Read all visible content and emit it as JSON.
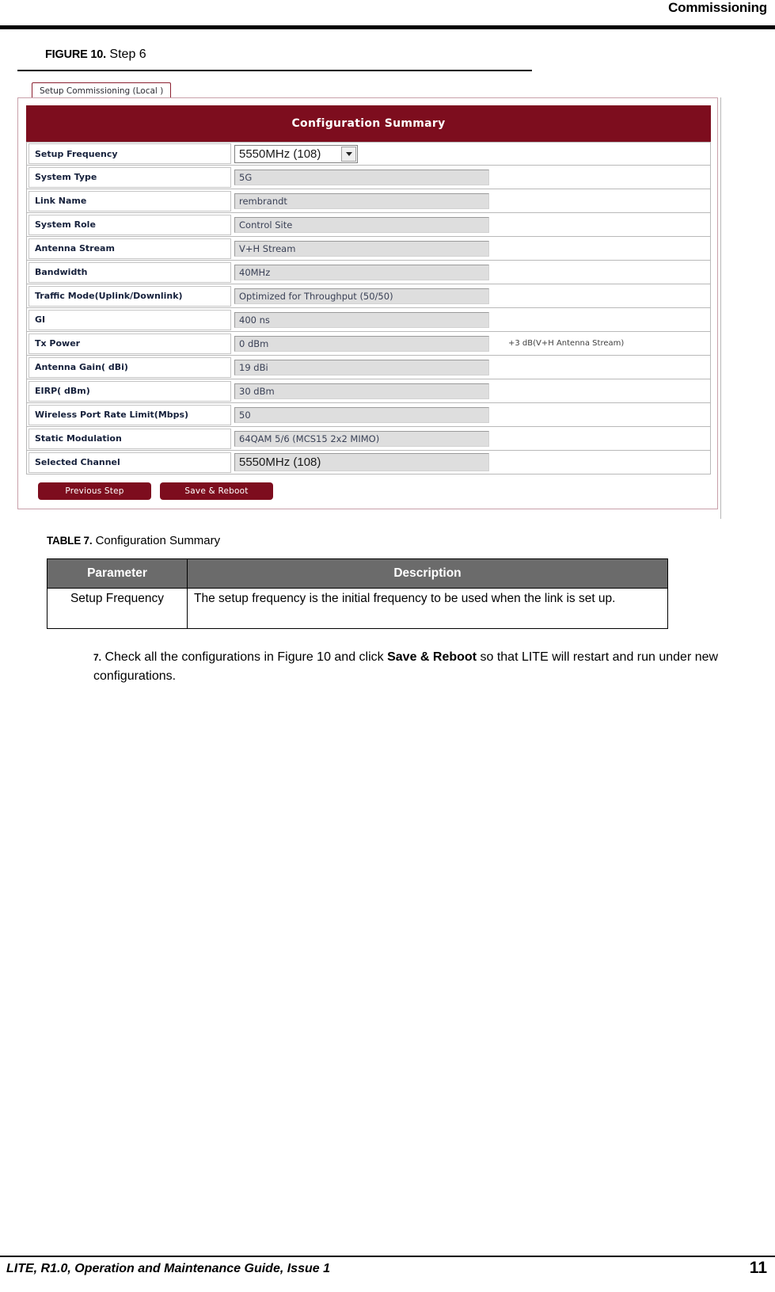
{
  "header": {
    "running_head": "Commissioning"
  },
  "figure": {
    "label": "FIGURE 10.",
    "title": "Step 6"
  },
  "screenshot": {
    "tab_label": "Setup Commissioning (Local )",
    "panel_title": "Configuration Summary",
    "rows": [
      {
        "label": "Setup Frequency",
        "value": "5550MHz (108)",
        "control": "select",
        "note": ""
      },
      {
        "label": "System Type",
        "value": "5G",
        "control": "text",
        "note": ""
      },
      {
        "label": "Link Name",
        "value": "rembrandt",
        "control": "text",
        "note": ""
      },
      {
        "label": "System Role",
        "value": "Control Site",
        "control": "text",
        "note": ""
      },
      {
        "label": "Antenna Stream",
        "value": "V+H Stream",
        "control": "text",
        "note": ""
      },
      {
        "label": "Bandwidth",
        "value": "40MHz",
        "control": "text",
        "note": ""
      },
      {
        "label": "Traffic Mode(Uplink/Downlink)",
        "value": "Optimized for Throughput (50/50)",
        "control": "text",
        "note": ""
      },
      {
        "label": "GI",
        "value": "400 ns",
        "control": "text",
        "note": ""
      },
      {
        "label": "Tx Power",
        "value": "0 dBm",
        "control": "text",
        "note": "+3 dB(V+H Antenna Stream)"
      },
      {
        "label": "Antenna Gain( dBi)",
        "value": "19 dBi",
        "control": "text",
        "note": ""
      },
      {
        "label": "EIRP( dBm)",
        "value": "30 dBm",
        "control": "text",
        "note": ""
      },
      {
        "label": "Wireless Port Rate Limit(Mbps)",
        "value": "50",
        "control": "text",
        "note": ""
      },
      {
        "label": "Static Modulation",
        "value": "64QAM 5/6 (MCS15  2x2 MIMO)",
        "control": "text",
        "note": ""
      },
      {
        "label": "Selected Channel",
        "value": "5550MHz (108)",
        "control": "text-large",
        "note": ""
      }
    ],
    "buttons": [
      {
        "label": "Previous Step"
      },
      {
        "label": "Save & Reboot"
      }
    ],
    "colors": {
      "accent_maroon": "#7d0d1e",
      "tab_border": "#8b2030",
      "field_gray": "#dedede"
    }
  },
  "table": {
    "label": "TABLE 7.",
    "title": "Configuration Summary",
    "columns": [
      "Parameter",
      "Description"
    ],
    "rows": [
      {
        "parameter": "Setup Frequency",
        "description": "The setup frequency is the initial frequency to be used when the link is set up."
      }
    ]
  },
  "step": {
    "number": "7.",
    "text_before": "Check all the configurations in Figure 10 and click ",
    "bold_text": "Save & Reboot",
    "text_after": " so that LITE will restart and run under new configurations."
  },
  "footer": {
    "guide_text": "LITE, R1.0, Operation and Maintenance Guide, Issue 1",
    "page_number": "11"
  }
}
